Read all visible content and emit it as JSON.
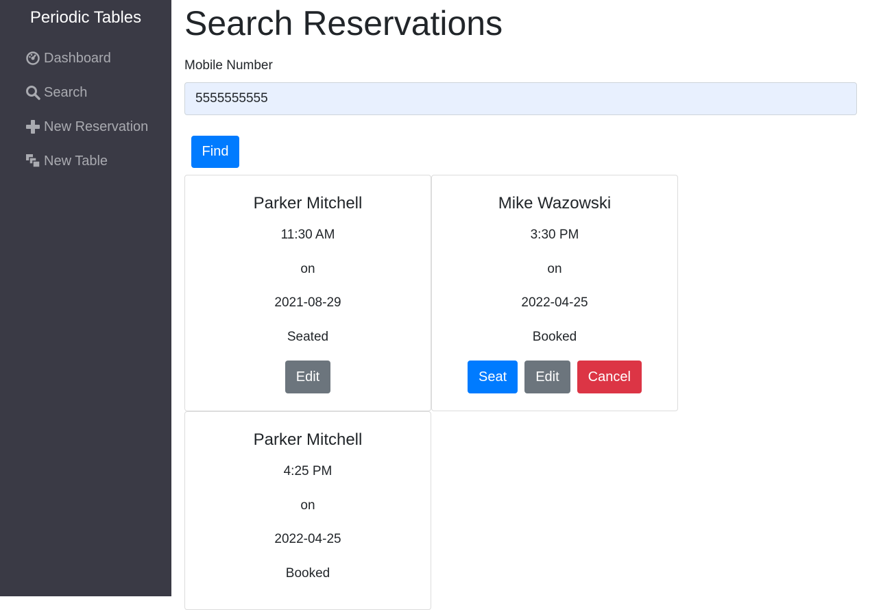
{
  "sidebar": {
    "brand": "Periodic Tables",
    "items": [
      {
        "label": "Dashboard",
        "icon": "dashboard-icon"
      },
      {
        "label": "Search",
        "icon": "search-icon"
      },
      {
        "label": "New Reservation",
        "icon": "plus-icon"
      },
      {
        "label": "New Table",
        "icon": "layers-icon"
      }
    ]
  },
  "page": {
    "title": "Search Reservations",
    "mobile_label": "Mobile Number",
    "mobile_value": "5555555555",
    "find_label": "Find"
  },
  "reservations": [
    {
      "name": "Parker Mitchell",
      "time": "11:30 AM",
      "on": "on",
      "date": "2021-08-29",
      "status": "Seated",
      "edit_label": "Edit"
    },
    {
      "name": "Mike Wazowski",
      "time": "3:30 PM",
      "on": "on",
      "date": "2022-04-25",
      "status": "Booked",
      "seat_label": "Seat",
      "edit_label": "Edit",
      "cancel_label": "Cancel"
    },
    {
      "name": "Parker Mitchell",
      "time": "4:25 PM",
      "on": "on",
      "date": "2022-04-25",
      "status": "Booked"
    }
  ],
  "colors": {
    "sidebar_bg": "#3a3a45",
    "primary": "#007bff",
    "secondary": "#6c757d",
    "danger": "#dc3545"
  }
}
